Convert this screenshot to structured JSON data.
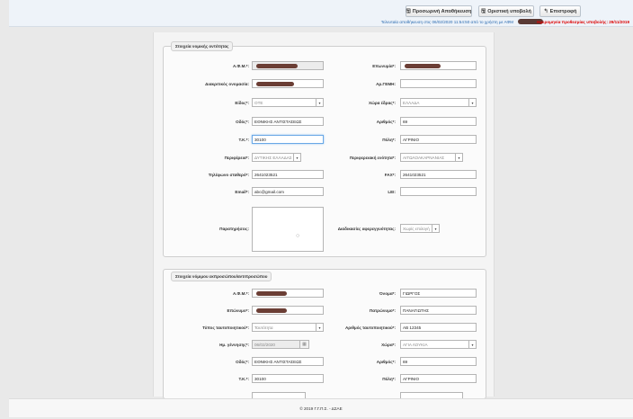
{
  "toolbar": {
    "save_temp": "Προσωρινή Αποθήκευση",
    "submit_final": "Οριστική υποβολή",
    "back": "Επιστροφή",
    "last_saved": "Τελευταία αποθήκευση στις 06/02/2020 11:54:50 από το χρήστη με ΑΦΜ",
    "deadline": "Ημερομηνία προθεσμίας υποβολής: 29/11/2019"
  },
  "section1": {
    "legend": "Στοιχεία νομικής οντότητας",
    "afm_label": "Α.Φ.Μ.*:",
    "name_label": "Επωνυμία*:",
    "distinct_label": "Διακριτικός ονομασία:",
    "gemi_label": "Αρ.ΓΕΜΗ:",
    "type_label": "Είδος*:",
    "type_value": "ΟΤΕ",
    "country_label": "Χώρα έδρας*:",
    "country_value": "ΕΛΛΑΔΑ",
    "street_label": "Οδός*:",
    "street_value": "ΕΘΝΙΚΗΣ ΑΝΤΙΣΤΑΣΕΩΣ",
    "number_label": "Αριθμός*:",
    "number_value": "69",
    "zip_label": "Τ.Κ.*:",
    "zip_value": "30100",
    "city_label": "Πόλη*:",
    "city_value": "ΑΓΡΙΝΙΟ",
    "region_label": "Περιφέρεια*:",
    "region_value": "ΔΥΤΙΚΗΣ ΕΛΛΑΔΑΣ",
    "unit_label": "Περιφερειακή ενότητα*:",
    "unit_value": "ΑΙΤΩΛΟΑΚΑΡΝΑΝΙΑΣ",
    "phone_label": "Τηλέφωνο σταθερό*:",
    "phone_value": "2641023521",
    "fax_label": "FAX*:",
    "fax_value": "2641023521",
    "email_label": "Email*:",
    "email_value": "abc@gmail.com",
    "lei_label": "LEI:",
    "notes_label": "Παρατηρήσεις:",
    "process_label": "Διαδικασίες αφερεγγυότητας:",
    "process_value": "Χωρίς επιλογή"
  },
  "section2": {
    "legend": "Στοιχεία νόμιμου εκπροσώπου/αντιπροσώπου",
    "afm_label": "Α.Φ.Μ.*:",
    "firstname_label": "Όνομα*:",
    "firstname_value": "ΓΙΩΡΓΟΣ",
    "lastname_label": "Επώνυμο*:",
    "father_label": "Πατρώνυμο*:",
    "father_value": "ΠΑΝΑΓΙΩΤΗΣ",
    "idtype_label": "Τύπος ταυτοποιητικού*:",
    "idtype_value": "Ταυτότητα",
    "idnum_label": "Αριθμός ταυτοποιητικού*:",
    "idnum_value": "ΑΒ 12345",
    "birth_label": "Ημ. γέννησης*:",
    "birth_value": "06/02/2020",
    "country_label": "Χώρα*:",
    "country_value": "ΑΓΙΑ ΛΟΥΚΙΑ",
    "street_label": "Οδός*:",
    "street_value": "ΕΘΝΙΚΗΣ ΑΝΤΙΣΤΑΣΕΩΣ",
    "number_label": "Αριθμός*:",
    "number_value": "69",
    "zip_label": "Τ.Κ.*:",
    "zip_value": "30100",
    "city_label": "Πόλη*:",
    "city_value": "ΑΓΡΙΝΙΟ"
  },
  "footer": {
    "text": "© 2019 Γ.Γ.Π.Σ. - ΔΣΑΕ"
  },
  "icons": {
    "save": "floppy-icon",
    "submit": "floppy-icon",
    "back": "back-arrow-icon",
    "calendar": "calendar-icon",
    "dropdown": "chevron-down-icon"
  },
  "colors": {
    "redaction": "#6b3e35",
    "deadline": "#dd0000",
    "info": "#2a6ab0"
  }
}
